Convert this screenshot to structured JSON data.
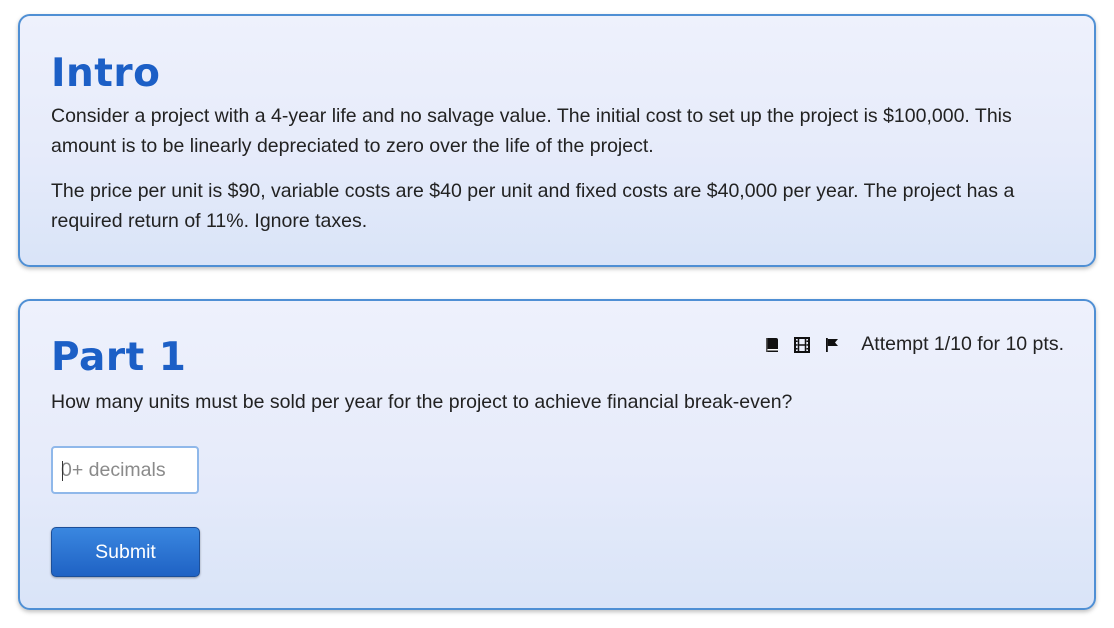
{
  "intro": {
    "heading": "Intro",
    "paragraph1": "Consider a project with a 4-year life and no salvage value. The initial cost to set up the project is $100,000. This amount is to be linearly depreciated to zero over the life of the project.",
    "paragraph2": "The price per unit is $90, variable costs are $40 per unit and fixed costs are $40,000 per year. The project has a required return of 11%. Ignore taxes."
  },
  "part1": {
    "heading": "Part 1",
    "attempt_text": "Attempt 1/10 for 10 pts.",
    "icons": [
      "book-icon",
      "film-icon",
      "flag-icon"
    ],
    "question": "How many units must be sold per year for the project to achieve financial break-even?",
    "answer": {
      "value": "",
      "placeholder": "0+ decimals"
    },
    "submit_label": "Submit"
  },
  "colors": {
    "heading": "#1c5fc6",
    "card_border": "#4f8fd4",
    "card_bg": "#e6ebfa",
    "button": "#1f62c4"
  }
}
